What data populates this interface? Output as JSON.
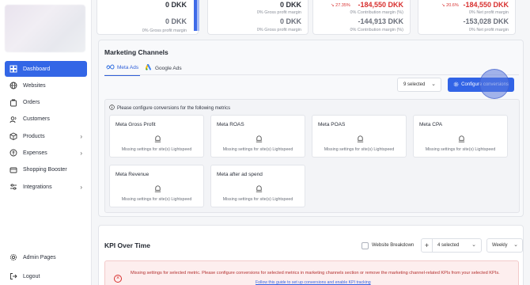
{
  "sidebar": {
    "items": [
      {
        "label": "Dashboard",
        "icon": "dashboard-icon",
        "active": true
      },
      {
        "label": "Websites",
        "icon": "globe-icon"
      },
      {
        "label": "Orders",
        "icon": "orders-icon"
      },
      {
        "label": "Customers",
        "icon": "customers-icon"
      },
      {
        "label": "Products",
        "icon": "box-icon",
        "has_children": true
      },
      {
        "label": "Expenses",
        "icon": "expenses-icon",
        "has_children": true
      },
      {
        "label": "Shopping Booster",
        "icon": "booster-icon"
      },
      {
        "label": "Integrations",
        "icon": "integrations-icon",
        "has_children": true
      }
    ],
    "admin_label": "Admin Pages",
    "logout_label": "Logout",
    "accent_color": "#3366e6"
  },
  "stats": [
    {
      "value": "0 DKK",
      "value2": "0 DKK",
      "sub": "0% Gross profit margin"
    },
    {
      "value": "0 DKK",
      "value2": "0 DKK",
      "sub1": "0% Gross profit margin",
      "sub2": "0% Gross profit margin"
    },
    {
      "pct": "↘ 27.35%",
      "value": "-184,550 DKK",
      "sub1": "0% Contribution margin (%)",
      "value2": "-144,913 DKK",
      "sub2": "0% Contribution margin (%)"
    },
    {
      "pct": "↘ 20.6%",
      "value": "-184,550 DKK",
      "sub1": "0% Net profit margin",
      "value2": "-153,028 DKK",
      "sub2": "0% Net profit margin"
    }
  ],
  "marketing": {
    "title": "Marketing Channels",
    "tabs": [
      {
        "label": "Meta Ads",
        "active": true
      },
      {
        "label": "Google Ads"
      }
    ],
    "selected_label": "9 selected",
    "configure_label": "Configure conversions",
    "notice": "Please configure conversions for the following metrics",
    "metrics": [
      {
        "title": "Meta Gross Profit",
        "message": "Missing settings for site(s) Lightspeed"
      },
      {
        "title": "Meta ROAS",
        "message": "Missing settings for site(s) Lightspeed"
      },
      {
        "title": "Meta POAS",
        "message": "Missing settings for site(s) Lightspeed"
      },
      {
        "title": "Meta CPA",
        "message": "Missing settings for site(s) Lightspeed"
      },
      {
        "title": "Meta Revenue",
        "message": "Missing settings for site(s) Lightspeed"
      },
      {
        "title": "Meta after ad spend",
        "message": "Missing settings for site(s) Lightspeed"
      }
    ]
  },
  "kpi": {
    "title": "KPI Over Time",
    "breakdown_label": "Website Breakdown",
    "selected_label": "4 selected",
    "period_label": "Weekly",
    "alert_text": "Missing settings for selected metric. Please configure conversions for selected metrics in marketing channels section or remove the marketing channel-related KPIs from your selected KPIs.",
    "alert_link": "Follow this guide to set up conversions and enable KPI tracking"
  }
}
